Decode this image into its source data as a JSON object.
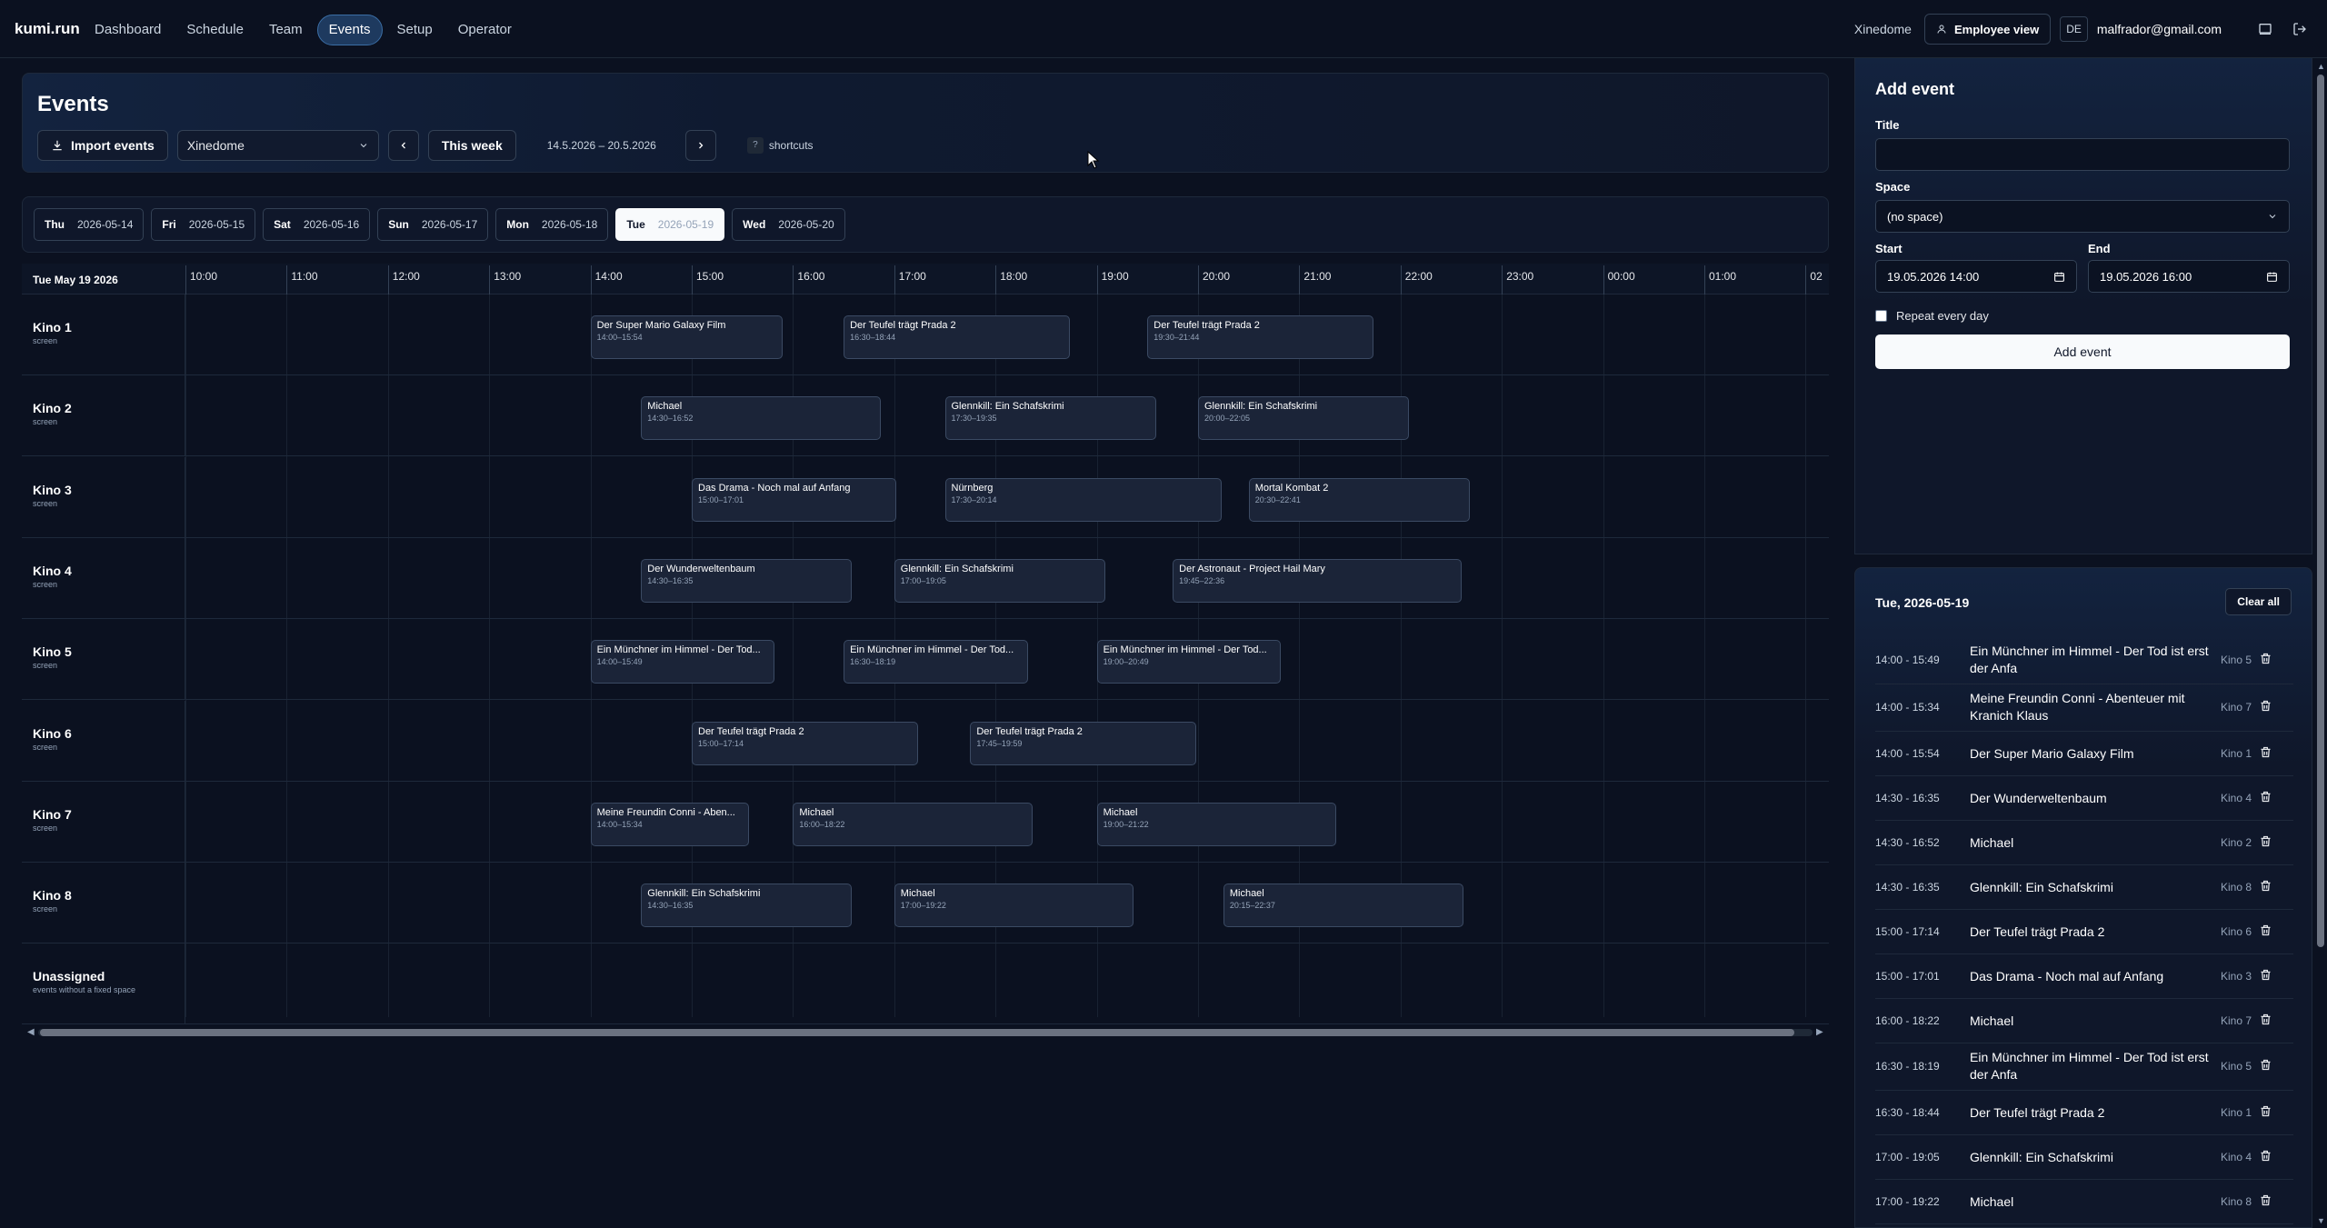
{
  "nav": {
    "brand": "kumi.run",
    "links": [
      "Dashboard",
      "Schedule",
      "Team",
      "Events",
      "Setup",
      "Operator"
    ],
    "active": "Events",
    "tenant": "Xinedome",
    "employee_view": "Employee view",
    "lang": "DE",
    "email": "malfrador@gmail.com"
  },
  "header": {
    "title": "Events",
    "import_label": "Import events",
    "venue_select": "Xinedome",
    "this_week": "This week",
    "date_range": "14.5.2026 – 20.5.2026",
    "shortcut_key": "?",
    "shortcuts_label": "shortcuts"
  },
  "days": [
    {
      "dow": "Thu",
      "date": "2026-05-14"
    },
    {
      "dow": "Fri",
      "date": "2026-05-15"
    },
    {
      "dow": "Sat",
      "date": "2026-05-16"
    },
    {
      "dow": "Sun",
      "date": "2026-05-17"
    },
    {
      "dow": "Mon",
      "date": "2026-05-18"
    },
    {
      "dow": "Tue",
      "date": "2026-05-19",
      "active": true
    },
    {
      "dow": "Wed",
      "date": "2026-05-20"
    }
  ],
  "timeline": {
    "date_label": "Tue May 19 2026",
    "hours": [
      "10:00",
      "11:00",
      "12:00",
      "13:00",
      "14:00",
      "15:00",
      "16:00",
      "17:00",
      "18:00",
      "19:00",
      "20:00",
      "21:00",
      "22:00",
      "23:00",
      "00:00",
      "01:00",
      "02"
    ],
    "rows": [
      {
        "name": "Kino 1",
        "sub": "screen",
        "events": [
          {
            "title": "Der Super Mario Galaxy Film",
            "time": "14:00–15:54",
            "start": 14.0,
            "end": 15.9
          },
          {
            "title": "Der Teufel trägt Prada 2",
            "time": "16:30–18:44",
            "start": 16.5,
            "end": 18.733
          },
          {
            "title": "Der Teufel trägt Prada 2",
            "time": "19:30–21:44",
            "start": 19.5,
            "end": 21.733
          }
        ]
      },
      {
        "name": "Kino 2",
        "sub": "screen",
        "events": [
          {
            "title": "Michael",
            "time": "14:30–16:52",
            "start": 14.5,
            "end": 16.867
          },
          {
            "title": "Glennkill: Ein Schafskrimi",
            "time": "17:30–19:35",
            "start": 17.5,
            "end": 19.583
          },
          {
            "title": "Glennkill: Ein Schafskrimi",
            "time": "20:00–22:05",
            "start": 20.0,
            "end": 22.083
          }
        ]
      },
      {
        "name": "Kino 3",
        "sub": "screen",
        "events": [
          {
            "title": "Das Drama - Noch mal auf Anfang",
            "time": "15:00–17:01",
            "start": 15.0,
            "end": 17.017
          },
          {
            "title": "Nürnberg",
            "time": "17:30–20:14",
            "start": 17.5,
            "end": 20.233
          },
          {
            "title": "Mortal Kombat 2",
            "time": "20:30–22:41",
            "start": 20.5,
            "end": 22.683
          }
        ]
      },
      {
        "name": "Kino 4",
        "sub": "screen",
        "events": [
          {
            "title": "Der Wunderweltenbaum",
            "time": "14:30–16:35",
            "start": 14.5,
            "end": 16.583
          },
          {
            "title": "Glennkill: Ein Schafskrimi",
            "time": "17:00–19:05",
            "start": 17.0,
            "end": 19.083
          },
          {
            "title": "Der Astronaut - Project Hail Mary",
            "time": "19:45–22:36",
            "start": 19.75,
            "end": 22.6
          }
        ]
      },
      {
        "name": "Kino 5",
        "sub": "screen",
        "events": [
          {
            "title": "Ein Münchner im Himmel - Der Tod...",
            "time": "14:00–15:49",
            "start": 14.0,
            "end": 15.817
          },
          {
            "title": "Ein Münchner im Himmel - Der Tod...",
            "time": "16:30–18:19",
            "start": 16.5,
            "end": 18.317
          },
          {
            "title": "Ein Münchner im Himmel - Der Tod...",
            "time": "19:00–20:49",
            "start": 19.0,
            "end": 20.817
          }
        ]
      },
      {
        "name": "Kino 6",
        "sub": "screen",
        "events": [
          {
            "title": "Der Teufel trägt Prada 2",
            "time": "15:00–17:14",
            "start": 15.0,
            "end": 17.233
          },
          {
            "title": "Der Teufel trägt Prada 2",
            "time": "17:45–19:59",
            "start": 17.75,
            "end": 19.983
          }
        ]
      },
      {
        "name": "Kino 7",
        "sub": "screen",
        "events": [
          {
            "title": "Meine Freundin Conni - Aben...",
            "time": "14:00–15:34",
            "start": 14.0,
            "end": 15.567
          },
          {
            "title": "Michael",
            "time": "16:00–18:22",
            "start": 16.0,
            "end": 18.367
          },
          {
            "title": "Michael",
            "time": "19:00–21:22",
            "start": 19.0,
            "end": 21.367
          }
        ]
      },
      {
        "name": "Kino 8",
        "sub": "screen",
        "events": [
          {
            "title": "Glennkill: Ein Schafskrimi",
            "time": "14:30–16:35",
            "start": 14.5,
            "end": 16.583
          },
          {
            "title": "Michael",
            "time": "17:00–19:22",
            "start": 17.0,
            "end": 19.367
          },
          {
            "title": "Michael",
            "time": "20:15–22:37",
            "start": 20.25,
            "end": 22.617
          }
        ]
      },
      {
        "name": "Unassigned",
        "sub": "events without a fixed space",
        "events": []
      }
    ]
  },
  "add_event": {
    "title": "Add event",
    "title_label": "Title",
    "title_value": "",
    "space_label": "Space",
    "space_value": "(no space)",
    "start_label": "Start",
    "start_value": "19.05.2026 14:00",
    "end_label": "End",
    "end_value": "19.05.2026 16:00",
    "repeat_label": "Repeat every day",
    "submit_label": "Add event"
  },
  "day_list": {
    "heading": "Tue, 2026-05-19",
    "clear_label": "Clear all",
    "items": [
      {
        "time": "14:00 - 15:49",
        "title": "Ein Münchner im Himmel - Der Tod ist erst der Anfa",
        "space": "Kino 5"
      },
      {
        "time": "14:00 - 15:34",
        "title": "Meine Freundin Conni - Abenteuer mit Kranich Klaus",
        "space": "Kino 7"
      },
      {
        "time": "14:00 - 15:54",
        "title": "Der Super Mario Galaxy Film",
        "space": "Kino 1"
      },
      {
        "time": "14:30 - 16:35",
        "title": "Der Wunderweltenbaum",
        "space": "Kino 4"
      },
      {
        "time": "14:30 - 16:52",
        "title": "Michael",
        "space": "Kino 2"
      },
      {
        "time": "14:30 - 16:35",
        "title": "Glennkill: Ein Schafskrimi",
        "space": "Kino 8"
      },
      {
        "time": "15:00 - 17:14",
        "title": "Der Teufel trägt Prada 2",
        "space": "Kino 6"
      },
      {
        "time": "15:00 - 17:01",
        "title": "Das Drama - Noch mal auf Anfang",
        "space": "Kino 3"
      },
      {
        "time": "16:00 - 18:22",
        "title": "Michael",
        "space": "Kino 7"
      },
      {
        "time": "16:30 - 18:19",
        "title": "Ein Münchner im Himmel - Der Tod ist erst der Anfa",
        "space": "Kino 5"
      },
      {
        "time": "16:30 - 18:44",
        "title": "Der Teufel trägt Prada 2",
        "space": "Kino 1"
      },
      {
        "time": "17:00 - 19:05",
        "title": "Glennkill: Ein Schafskrimi",
        "space": "Kino 4"
      },
      {
        "time": "17:00 - 19:22",
        "title": "Michael",
        "space": "Kino 8"
      }
    ]
  }
}
